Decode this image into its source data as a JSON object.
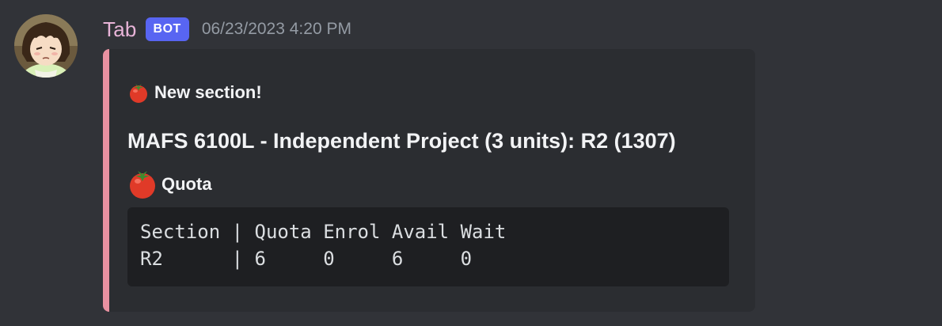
{
  "message": {
    "username": "Tab",
    "badge": "BOT",
    "timestamp": "06/23/2023 4:20 PM",
    "avatar_icon": "anime-girl-avatar",
    "username_color": "#e8b4d8"
  },
  "embed": {
    "accent_color": "#e891a1",
    "author": {
      "emoji": "tomato",
      "text": "New section!"
    },
    "title": "MAFS 6100L - Independent Project (3 units): R2 (1307)",
    "field": {
      "emoji": "tomato",
      "name": "Quota",
      "code_lines": [
        "Section | Quota Enrol Avail Wait",
        "R2      | 6     0     6     0"
      ]
    }
  }
}
